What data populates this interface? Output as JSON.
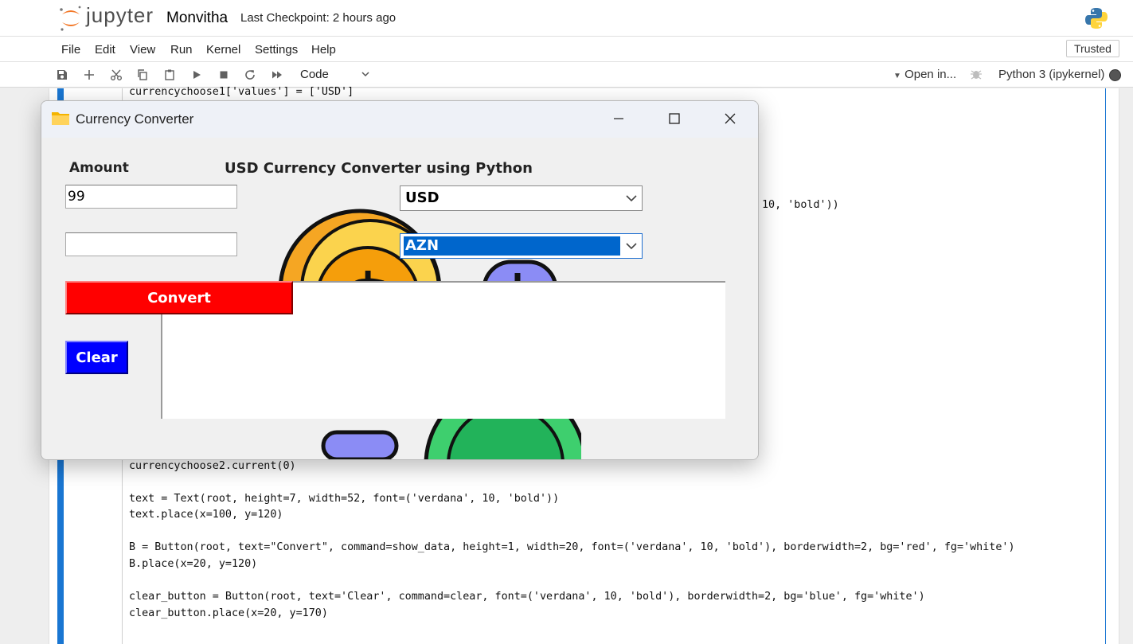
{
  "header": {
    "logo_text": "jupyter",
    "notebook_title": "Monvitha",
    "checkpoint": "Last Checkpoint: 2 hours ago"
  },
  "menubar": {
    "items": [
      "File",
      "Edit",
      "View",
      "Run",
      "Kernel",
      "Settings",
      "Help"
    ],
    "trusted": "Trusted"
  },
  "toolbar": {
    "cell_type": "Code",
    "open_in": "Open in...",
    "kernel": "Python 3 (ipykernel)"
  },
  "code": {
    "line_top": "currencychoose1['values'] = ['USD']",
    "line_partial": "10, 'bold'))",
    "line_current": "currencychoose2.current(0)",
    "line_text": "text = Text(root, height=7, width=52, font=('verdana', 10, 'bold'))",
    "line_text_place": "text.place(x=100, y=120)",
    "line_b": "B = Button(root, text=\"Convert\", command=show_data, height=1, width=20, font=('verdana', 10, 'bold'), borderwidth=2, bg='red', fg='white')",
    "line_b_place": "B.place(x=20, y=120)",
    "line_clear": "clear_button = Button(root, text='Clear', command=clear, font=('verdana', 10, 'bold'), borderwidth=2, bg='blue', fg='white')",
    "line_clear_place": "clear_button.place(x=20, y=170)"
  },
  "tk_window": {
    "title": "Currency Converter",
    "amount_label": "Amount",
    "heading": "USD Currency Converter using Python",
    "amount_value": "99",
    "result_value": "",
    "from_currency": "USD",
    "to_currency": "AZN",
    "convert_label": "Convert",
    "clear_label": "Clear",
    "text_area_value": ""
  },
  "colors": {
    "convert_bg": "#ff0000",
    "clear_bg": "#0000ff",
    "cell_accent": "#1976d2"
  }
}
